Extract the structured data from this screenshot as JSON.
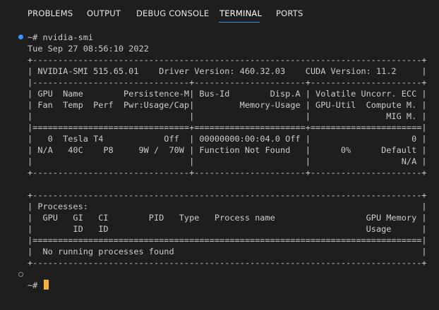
{
  "panel": {
    "tabs": [
      {
        "label": "PROBLEMS"
      },
      {
        "label": "OUTPUT"
      },
      {
        "label": "DEBUG CONSOLE"
      },
      {
        "label": "TERMINAL"
      },
      {
        "label": "PORTS"
      }
    ],
    "active_tab": "TERMINAL"
  },
  "terminal": {
    "lines": [
      "~# nvidia-smi",
      "Tue Sep 27 08:56:10 2022",
      "+-----------------------------------------------------------------------------+",
      "| NVIDIA-SMI 515.65.01    Driver Version: 460.32.03    CUDA Version: 11.2     |",
      "|-------------------------------+----------------------+----------------------+",
      "| GPU  Name        Persistence-M| Bus-Id        Disp.A | Volatile Uncorr. ECC |",
      "| Fan  Temp  Perf  Pwr:Usage/Cap|         Memory-Usage | GPU-Util  Compute M. |",
      "|                               |                      |               MIG M. |",
      "|===============================+======================+======================|",
      "|   0  Tesla T4            Off  | 00000000:00:04.0 Off |                    0 |",
      "| N/A   40C    P8     9W /  70W | Function Not Found   |      0%      Default |",
      "|                               |                      |                  N/A |",
      "+-------------------------------+----------------------+----------------------+",
      "",
      "+-----------------------------------------------------------------------------+",
      "| Processes:                                                                  |",
      "|  GPU   GI   CI        PID   Type   Process name                  GPU Memory |",
      "|        ID   ID                                                   Usage      |",
      "|=============================================================================|",
      "|  No running processes found                                                 |",
      "+-----------------------------------------------------------------------------+"
    ],
    "prompt": "~#"
  },
  "colors": {
    "background": "#1e1e1e",
    "text": "#cccccc",
    "active_tab_underline": "#3b8eea",
    "command_success_dot": "#3794ff",
    "cursor": "#f0b442"
  }
}
